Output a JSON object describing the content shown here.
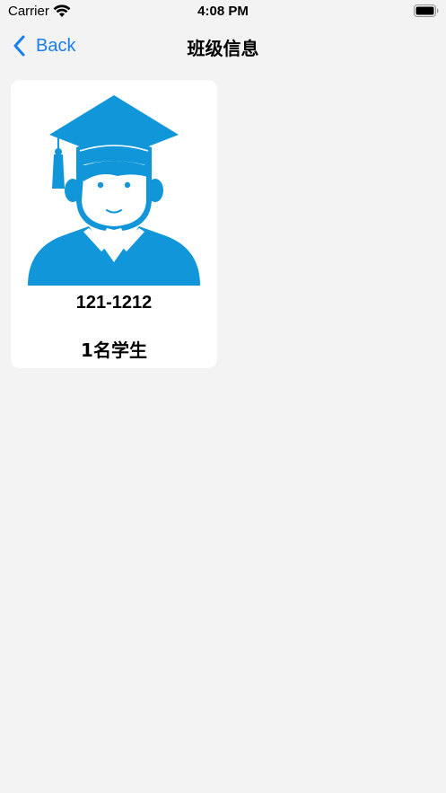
{
  "status_bar": {
    "carrier": "Carrier",
    "time": "4:08 PM",
    "wifi_icon": "wifi-icon",
    "battery_icon": "battery-full-icon"
  },
  "nav": {
    "back_label": "Back",
    "back_icon": "chevron-left-icon",
    "title": "班级信息"
  },
  "classes": [
    {
      "name": "121-1212",
      "student_count": "1名学生",
      "icon": "graduate-avatar-icon"
    }
  ],
  "colors": {
    "accent": "#1a7ef2",
    "avatar": "#1196d9",
    "background": "#f3f3f3",
    "card": "#ffffff"
  }
}
